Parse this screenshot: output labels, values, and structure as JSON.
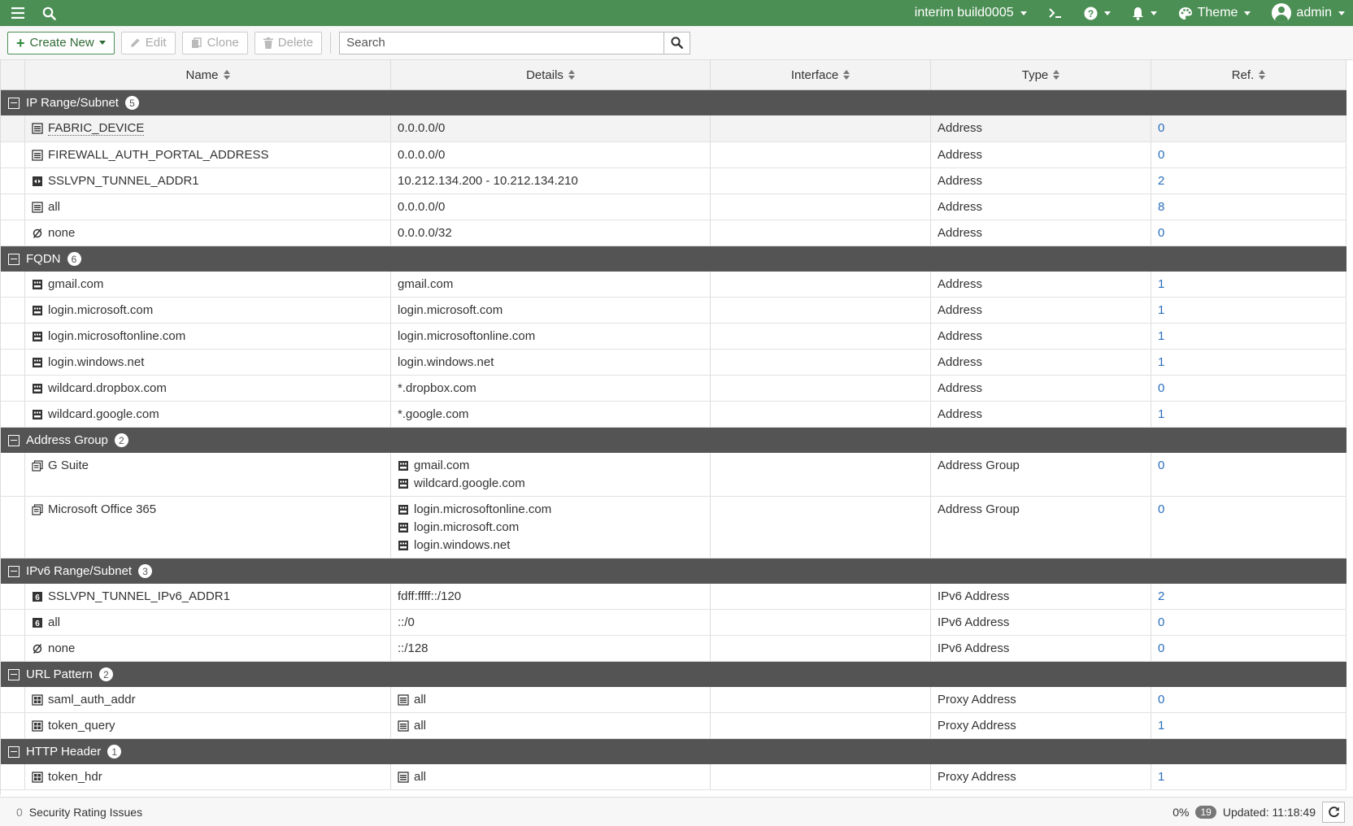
{
  "topbar": {
    "build_label": "interim build0005",
    "theme_label": "Theme",
    "user_label": "admin"
  },
  "toolbar": {
    "create_label": "Create New",
    "edit_label": "Edit",
    "clone_label": "Clone",
    "delete_label": "Delete",
    "search_placeholder": "Search"
  },
  "columns": {
    "name": "Name",
    "details": "Details",
    "interface": "Interface",
    "type": "Type",
    "ref": "Ref."
  },
  "groups": [
    {
      "label": "IP Range/Subnet",
      "count": "5",
      "rows": [
        {
          "icon": "address",
          "name": "FABRIC_DEVICE",
          "details": [
            "0.0.0.0/0"
          ],
          "interface": "",
          "type": "Address",
          "ref": "0"
        },
        {
          "icon": "address",
          "name": "FIREWALL_AUTH_PORTAL_ADDRESS",
          "details": [
            "0.0.0.0/0"
          ],
          "interface": "",
          "type": "Address",
          "ref": "0"
        },
        {
          "icon": "range",
          "name": "SSLVPN_TUNNEL_ADDR1",
          "details": [
            "10.212.134.200 - 10.212.134.210"
          ],
          "interface": "",
          "type": "Address",
          "ref": "2"
        },
        {
          "icon": "address",
          "name": "all",
          "details": [
            "0.0.0.0/0"
          ],
          "interface": "",
          "type": "Address",
          "ref": "8"
        },
        {
          "icon": "none",
          "name": "none",
          "details": [
            "0.0.0.0/32"
          ],
          "interface": "",
          "type": "Address",
          "ref": "0"
        }
      ]
    },
    {
      "label": "FQDN",
      "count": "6",
      "rows": [
        {
          "icon": "fqdn",
          "name": "gmail.com",
          "details": [
            "gmail.com"
          ],
          "interface": "",
          "type": "Address",
          "ref": "1"
        },
        {
          "icon": "fqdn",
          "name": "login.microsoft.com",
          "details": [
            "login.microsoft.com"
          ],
          "interface": "",
          "type": "Address",
          "ref": "1"
        },
        {
          "icon": "fqdn",
          "name": "login.microsoftonline.com",
          "details": [
            "login.microsoftonline.com"
          ],
          "interface": "",
          "type": "Address",
          "ref": "1"
        },
        {
          "icon": "fqdn",
          "name": "login.windows.net",
          "details": [
            "login.windows.net"
          ],
          "interface": "",
          "type": "Address",
          "ref": "1"
        },
        {
          "icon": "fqdn",
          "name": "wildcard.dropbox.com",
          "details": [
            "*.dropbox.com"
          ],
          "interface": "",
          "type": "Address",
          "ref": "0"
        },
        {
          "icon": "fqdn",
          "name": "wildcard.google.com",
          "details": [
            "*.google.com"
          ],
          "interface": "",
          "type": "Address",
          "ref": "1"
        }
      ]
    },
    {
      "label": "Address Group",
      "count": "2",
      "rows": [
        {
          "icon": "group",
          "name": "G Suite",
          "details": [
            "gmail.com",
            "wildcard.google.com"
          ],
          "detail_icon": "fqdn",
          "interface": "",
          "type": "Address Group",
          "ref": "0"
        },
        {
          "icon": "group",
          "name": "Microsoft Office 365",
          "details": [
            "login.microsoftonline.com",
            "login.microsoft.com",
            "login.windows.net"
          ],
          "detail_icon": "fqdn",
          "interface": "",
          "type": "Address Group",
          "ref": "0"
        }
      ]
    },
    {
      "label": "IPv6 Range/Subnet",
      "count": "3",
      "rows": [
        {
          "icon": "ipv6",
          "name": "SSLVPN_TUNNEL_IPv6_ADDR1",
          "details": [
            "fdff:ffff::/120"
          ],
          "interface": "",
          "type": "IPv6 Address",
          "ref": "2"
        },
        {
          "icon": "ipv6",
          "name": "all",
          "details": [
            "::/0"
          ],
          "interface": "",
          "type": "IPv6 Address",
          "ref": "0"
        },
        {
          "icon": "none",
          "name": "none",
          "details": [
            "::/128"
          ],
          "interface": "",
          "type": "IPv6 Address",
          "ref": "0"
        }
      ]
    },
    {
      "label": "URL Pattern",
      "count": "2",
      "rows": [
        {
          "icon": "proxy",
          "name": "saml_auth_addr",
          "details": [
            "all"
          ],
          "detail_icon": "address",
          "interface": "",
          "type": "Proxy Address",
          "ref": "0"
        },
        {
          "icon": "proxy",
          "name": "token_query",
          "details": [
            "all"
          ],
          "detail_icon": "address",
          "interface": "",
          "type": "Proxy Address",
          "ref": "1"
        }
      ]
    },
    {
      "label": "HTTP Header",
      "count": "1",
      "rows": [
        {
          "icon": "proxy",
          "name": "token_hdr",
          "details": [
            "all"
          ],
          "detail_icon": "address",
          "interface": "",
          "type": "Proxy Address",
          "ref": "1"
        }
      ]
    }
  ],
  "footer": {
    "issues_count": "0",
    "issues_label": "Security Rating Issues",
    "percent": "0%",
    "badge": "19",
    "updated": "Updated: 11:18:49"
  }
}
